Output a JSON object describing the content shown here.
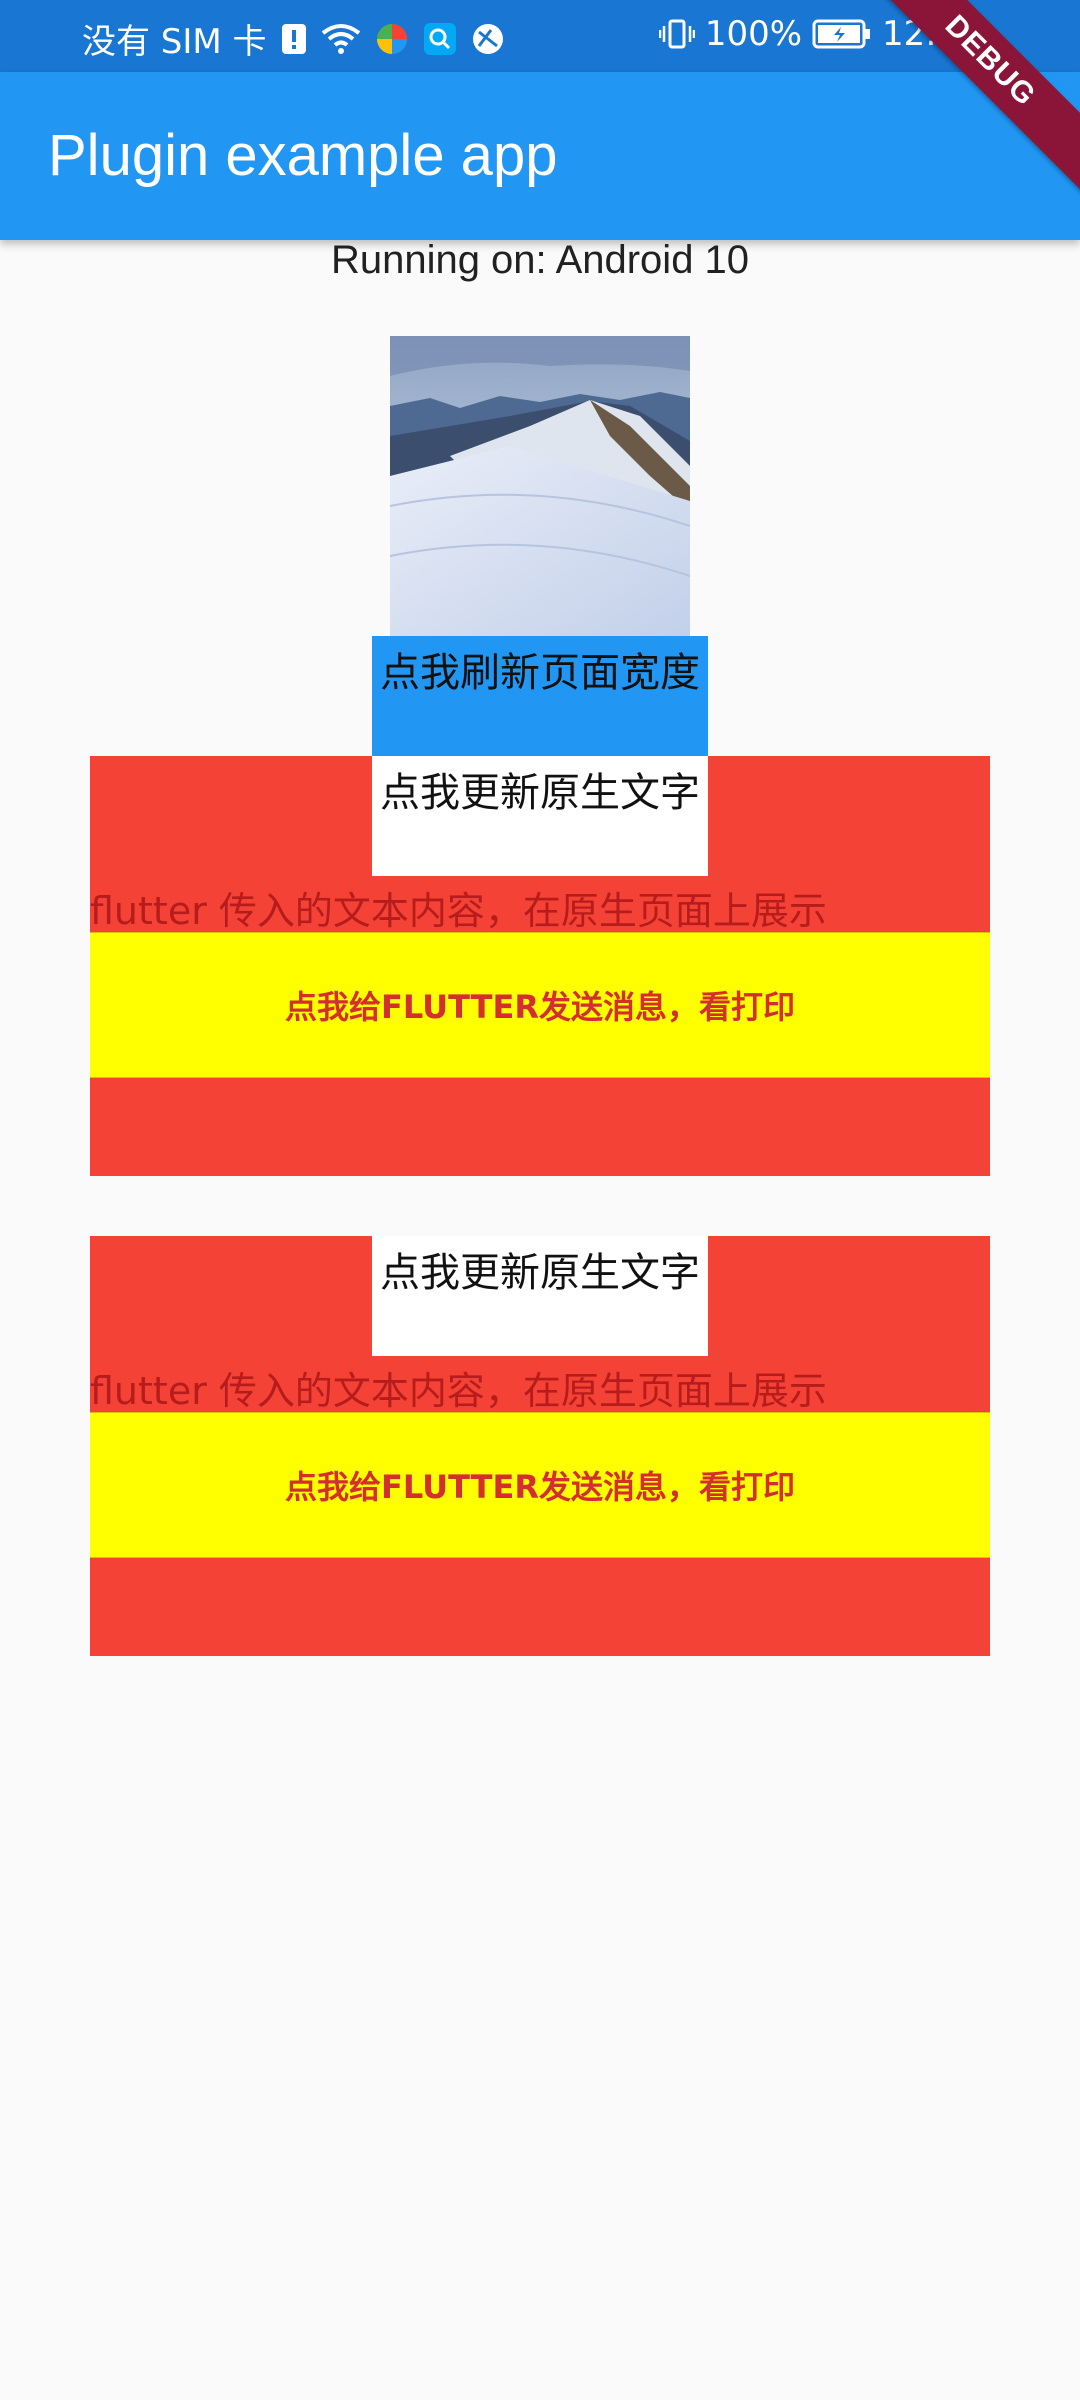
{
  "status_bar": {
    "carrier": "没有 SIM 卡",
    "battery": "100%",
    "time": "12:39"
  },
  "app_bar": {
    "title": "Plugin example app"
  },
  "debug_banner": "DEBUG",
  "platform_text": "Running on: Android 10",
  "refresh_button": "点我刷新页面宽度",
  "native_views": [
    {
      "update_button": "点我更新原生文字",
      "native_text": "flutter 传入的文本内容，在原生页面上展示",
      "send_button": "点我给FLUTTER发送消息，看打印"
    },
    {
      "update_button": "点我更新原生文字",
      "native_text": "flutter 传入的文本内容，在原生页面上展示",
      "send_button": "点我给FLUTTER发送消息，看打印"
    }
  ],
  "colors": {
    "status_bar": "#1976d2",
    "app_bar": "#2196f3",
    "native_background": "#f44336",
    "send_button": "#ffff00",
    "send_text": "#d32f2f"
  }
}
